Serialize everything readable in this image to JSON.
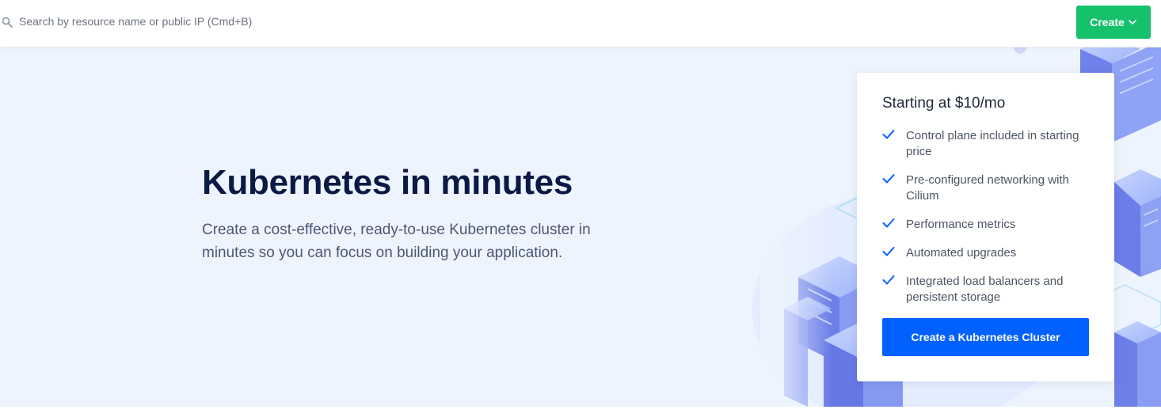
{
  "search": {
    "placeholder": "Search by resource name or public IP (Cmd+B)"
  },
  "header": {
    "create_label": "Create"
  },
  "hero": {
    "title": "Kubernetes in minutes",
    "description": "Create a cost-effective, ready-to-use Kubernetes cluster in minutes so you can focus on building your application."
  },
  "pricing_card": {
    "title": "Starting at $10/mo",
    "features": [
      "Control plane included in starting price",
      "Pre-configured networking with Cilium",
      "Performance metrics",
      "Automated upgrades",
      "Integrated load balancers and persistent storage"
    ],
    "cta_label": "Create a Kubernetes Cluster"
  },
  "colors": {
    "create_button": "#15c26b",
    "primary_button": "#0061fe",
    "hero_background": "#eef4fe",
    "title_text": "#0a1a45",
    "check_icon": "#0061fe"
  },
  "icons": {
    "search": "search-icon",
    "dropdown": "chevron-down-icon",
    "feature_check": "check-icon"
  }
}
